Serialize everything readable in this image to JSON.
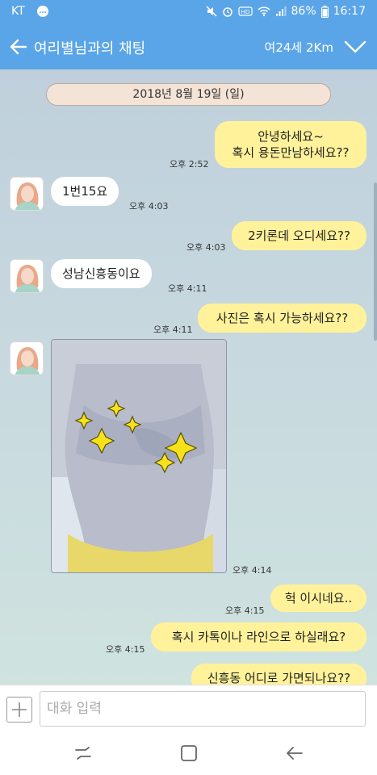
{
  "status_bar": {
    "carrier": "KT",
    "battery": "86%",
    "time": "16:17",
    "icons": [
      "kakaotalk-notification-icon",
      "mute-icon",
      "alarm-icon",
      "hd-voice-icon",
      "wifi-icon",
      "signal-icon",
      "battery-icon"
    ]
  },
  "header": {
    "title": "여리별님과의 채팅",
    "meta": "여24세 2Km",
    "accent_color": "#5aa5e8"
  },
  "date_divider": "2018년 8월 19일 (일)",
  "messages": [
    {
      "from": "me",
      "lines": [
        "안녕하세요~",
        "혹시 용돈만남하세요??"
      ],
      "time": "오후 2:52"
    },
    {
      "from": "them",
      "text": "1번15요",
      "time": "오후 4:03"
    },
    {
      "from": "me",
      "text": "2키론데 오디세요??",
      "time": "오후 4:03"
    },
    {
      "from": "them",
      "text": "성남신흥동이요",
      "time": "오후 4:11"
    },
    {
      "from": "me",
      "text": "사진은 혹시 가능하세요??",
      "time": "오후 4:11"
    },
    {
      "from": "them",
      "type": "photo",
      "time": "오후 4:14"
    },
    {
      "from": "me",
      "text": "헉 이시네요..",
      "time": "오후 4:15"
    },
    {
      "from": "me",
      "text": "혹시 카톡이나 라인으로 하실래요?",
      "time": "오후 4:15"
    },
    {
      "from": "me",
      "text": "신흥동 어디로 가면되나요??"
    }
  ],
  "input": {
    "placeholder": "대화 입력"
  },
  "bubble_colors": {
    "mine": "#fff29a",
    "theirs": "#ffffff"
  }
}
